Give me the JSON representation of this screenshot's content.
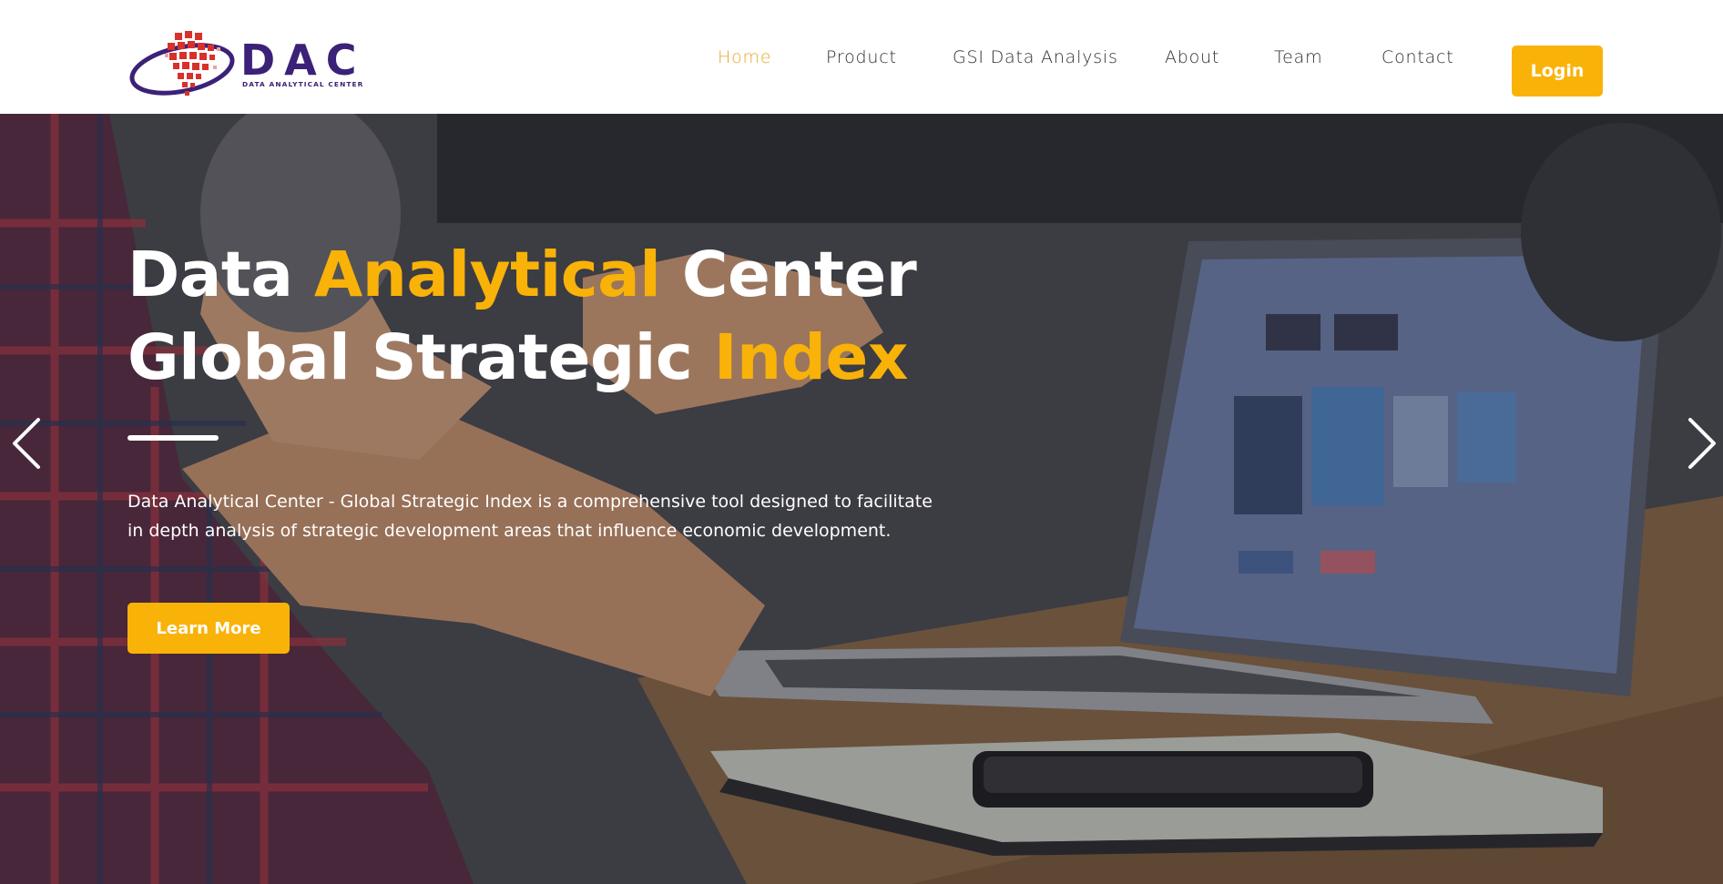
{
  "brand": {
    "logo_text": "DAC",
    "logo_subtitle": "DATA ANALYTICAL CENTER"
  },
  "nav": {
    "items": [
      {
        "label": "Home",
        "active": true
      },
      {
        "label": "Product",
        "active": false
      },
      {
        "label": "GSI Data Analysis",
        "active": false
      },
      {
        "label": "About",
        "active": false
      },
      {
        "label": "Team",
        "active": false
      },
      {
        "label": "Contact",
        "active": false
      }
    ],
    "login_label": "Login"
  },
  "hero": {
    "title_line1_part1": "Data ",
    "title_line1_accent": "Analytical",
    "title_line1_part2": " Center",
    "title_line2_part1": "Global Strategic ",
    "title_line2_accent": "Index",
    "description": "Data Analytical Center - Global Strategic Index is a comprehensive tool designed to facilitate in depth analysis of strategic development areas that influence economic development.",
    "cta_label": "Learn More"
  },
  "colors": {
    "accent": "#f9b208",
    "nav_active": "#e8a72c",
    "brand_purple": "#3b2178",
    "logo_red": "#d8302a"
  },
  "icons": {
    "prev": "chevron-left-icon",
    "next": "chevron-right-icon"
  }
}
